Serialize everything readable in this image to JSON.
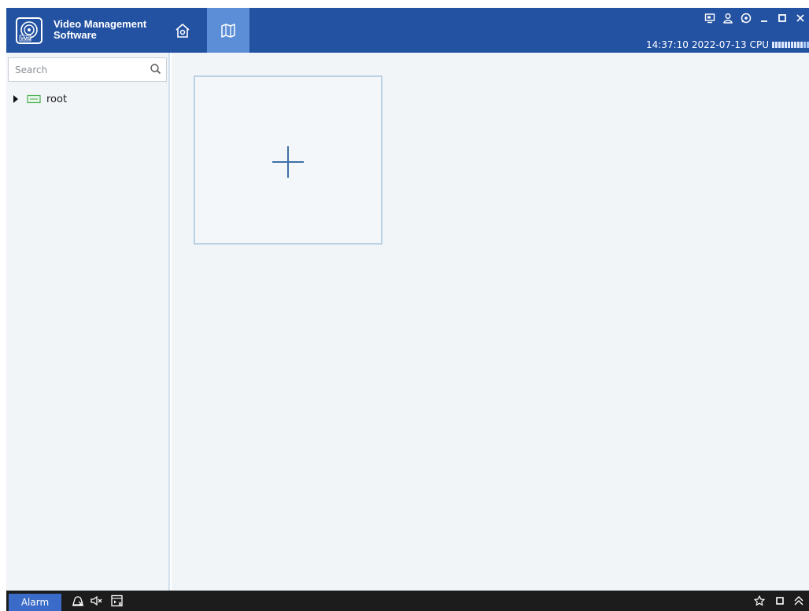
{
  "app": {
    "title_line1": "Video Management",
    "title_line2": "Software",
    "logo_text": "VMS"
  },
  "status": {
    "time": "14:37:10",
    "date": "2022-07-13",
    "cpu_label": "CPU",
    "cpu_level": 0.8
  },
  "search": {
    "placeholder": "Search",
    "value": ""
  },
  "tree": {
    "root_label": "root"
  },
  "alarm": {
    "label": "Alarm"
  },
  "colors": {
    "titlebar": "#2352a2",
    "active_tab": "#5b8ed6",
    "panel_bg": "#f2f5f8",
    "tile_border": "#b9d0e5",
    "plus": "#3f6fa8",
    "alarm_button": "#3a6bc8",
    "bottom_bar": "#1c1c1c",
    "device_icon": "#4caf50"
  },
  "icons": {
    "nav": [
      "home-icon",
      "map-icon"
    ],
    "window": [
      "screen-icon",
      "user-icon",
      "lock-icon",
      "minimize-icon",
      "maximize-icon",
      "close-icon"
    ],
    "bottom_left": [
      "alarm-off-icon",
      "mute-icon",
      "window-close-icon"
    ],
    "bottom_right": [
      "pin-icon",
      "restore-icon",
      "collapse-up-icon"
    ]
  }
}
